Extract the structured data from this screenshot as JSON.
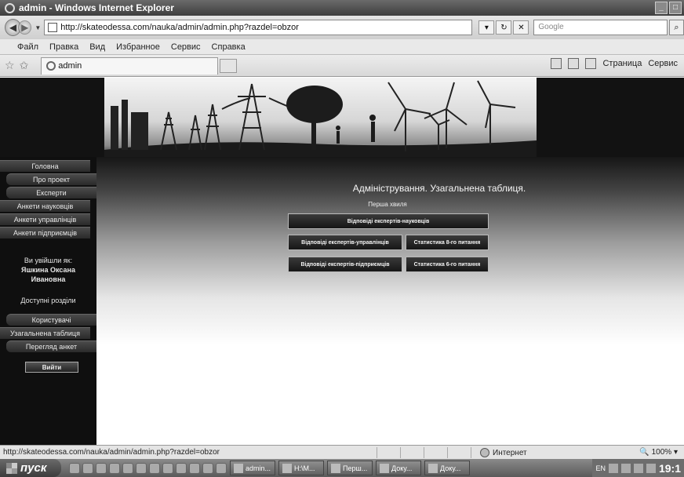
{
  "window": {
    "title": "admin - Windows Internet Explorer"
  },
  "addressbar": {
    "url": "http://skateodessa.com/nauka/admin/admin.php?razdel=obzor",
    "search_placeholder": "Google"
  },
  "menubar": {
    "items": [
      "Файл",
      "Правка",
      "Вид",
      "Избранное",
      "Сервис",
      "Справка"
    ]
  },
  "tabbar": {
    "tab_title": "admin",
    "page_label": "Страница",
    "tools_label": "Сервис"
  },
  "sidebar": {
    "nav": [
      "Головна",
      "Про проект",
      "Експерти",
      "Анкети науковців",
      "Анкети управлінців",
      "Анкети підприємців"
    ],
    "logged_in_label": "Ви увійшли як:",
    "user_name": "Яшкина Оксана Ивановна",
    "sections_label": "Доступні розділи",
    "sections": [
      "Користувачі",
      "Узагальнена таблиця",
      "Перегляд анкет"
    ],
    "exit_label": "Вийти"
  },
  "main": {
    "title": "Адміністрування. Узагальнена таблиця.",
    "wave_label": "Перша хвиля",
    "buttons": {
      "scientists": "Відповіді експертів-науковців",
      "managers": "Відповіді експертів-управлінців",
      "stats8": "Статистика 8-го питання",
      "entrepreneurs": "Відповіді експертів-підприємців",
      "stats6": "Статистика 6-го питання"
    }
  },
  "statusbar": {
    "url": "http://skateodessa.com/nauka/admin/admin.php?razdel=obzor",
    "zone": "Интернет",
    "zoom": "100%"
  },
  "taskbar": {
    "start_label": "пуск",
    "tasks": [
      "admin...",
      "H:\\M...",
      "Перш...",
      "Доку...",
      "Доку..."
    ],
    "lang": "EN",
    "clock": "19:1"
  }
}
